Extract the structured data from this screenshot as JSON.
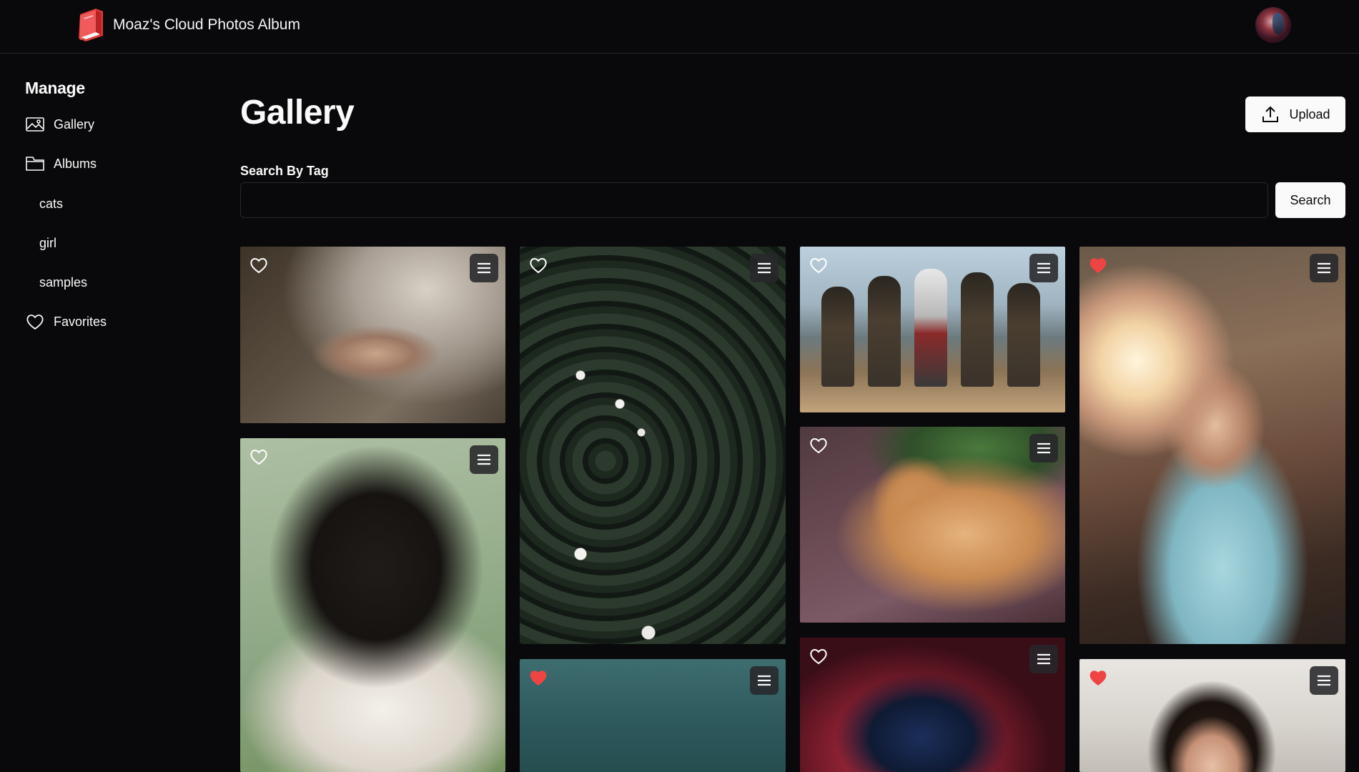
{
  "header": {
    "app_title": "Moaz's Cloud Photos Album",
    "logo_icon": "red-book-icon",
    "avatar_icon": "user-avatar"
  },
  "sidebar": {
    "heading": "Manage",
    "items": [
      {
        "label": "Gallery",
        "icon": "image-icon"
      },
      {
        "label": "Albums",
        "icon": "folder-icon"
      },
      {
        "label": "Favorites",
        "icon": "heart-icon"
      }
    ],
    "albums": [
      "cats",
      "girl",
      "samples"
    ]
  },
  "main": {
    "title": "Gallery",
    "upload_label": "Upload",
    "search_label": "Search By Tag",
    "search_value": "",
    "search_button": "Search"
  },
  "photos": [
    {
      "subject": "wedding-hands",
      "favorited": false
    },
    {
      "subject": "girl-by-water",
      "favorited": false
    },
    {
      "subject": "water-lilies",
      "favorited": false
    },
    {
      "subject": "teal-sky",
      "favorited": true
    },
    {
      "subject": "pirates-group",
      "favorited": false
    },
    {
      "subject": "orange-cat",
      "favorited": false
    },
    {
      "subject": "anime-character",
      "favorited": false
    },
    {
      "subject": "woman-sunlight",
      "favorited": true
    },
    {
      "subject": "woman-portrait",
      "favorited": true
    }
  ],
  "colors": {
    "background": "#09090b",
    "border": "#27272a",
    "button_bg": "#fafafa",
    "favorite_red": "#ef4444"
  }
}
